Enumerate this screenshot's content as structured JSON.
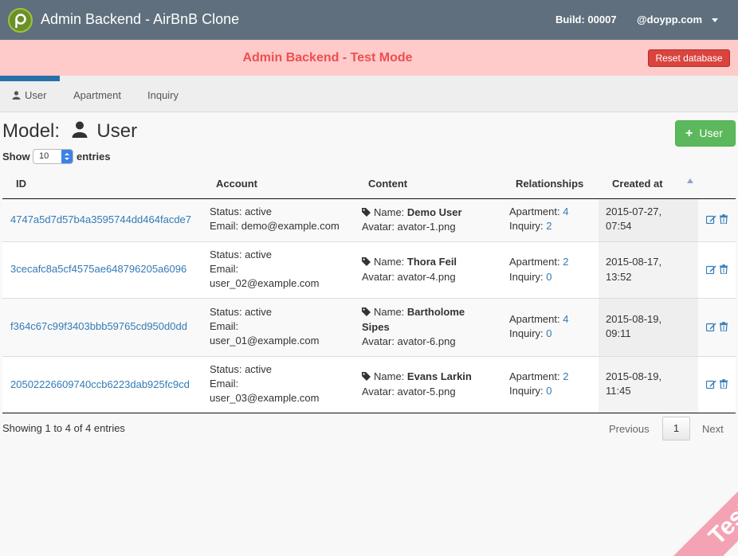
{
  "app": {
    "title": "Admin Backend - AirBnB Clone",
    "build": "Build: 00007",
    "user": "@doypp.com"
  },
  "banner": {
    "title": "Admin Backend - Test Mode",
    "reset_label": "Reset database"
  },
  "tabs": [
    {
      "label": "User",
      "active": true
    },
    {
      "label": "Apartment",
      "active": false
    },
    {
      "label": "Inquiry",
      "active": false
    }
  ],
  "model": {
    "prefix": "Model:",
    "name": "User",
    "add_label": "User"
  },
  "entries": {
    "show": "Show",
    "value": "10",
    "suffix": "entries"
  },
  "table": {
    "columns": [
      "ID",
      "Account",
      "Content",
      "Relationships",
      "Created at"
    ],
    "rows": [
      {
        "id": "4747a5d7d57b4a3595744dd464facde7",
        "status": "Status: active",
        "email_prefix": "Email:",
        "email": "demo@example.com",
        "name_prefix": "Name:",
        "name": "Demo User",
        "avatar": "Avatar: avator-1.png",
        "apartment_label": "Apartment:",
        "apartment": "4",
        "inquiry_label": "Inquiry:",
        "inquiry": "2",
        "created_date": "2015-07-27,",
        "created_time": "07:54"
      },
      {
        "id": "3cecafc8a5cf4575ae648796205a6096",
        "status": "Status: active",
        "email_prefix": "Email:",
        "email": "user_02@example.com",
        "name_prefix": "Name:",
        "name": "Thora Feil",
        "avatar": "Avatar: avator-4.png",
        "apartment_label": "Apartment:",
        "apartment": "2",
        "inquiry_label": "Inquiry:",
        "inquiry": "0",
        "created_date": "2015-08-17,",
        "created_time": "13:52"
      },
      {
        "id": "f364c67c99f3403bbb59765cd950d0dd",
        "status": "Status: active",
        "email_prefix": "Email:",
        "email": "user_01@example.com",
        "name_prefix": "Name:",
        "name_line1": "Bartholome",
        "name_line2": "Sipes",
        "avatar": "Avatar: avator-6.png",
        "apartment_label": "Apartment:",
        "apartment": "4",
        "inquiry_label": "Inquiry:",
        "inquiry": "0",
        "created_date": "2015-08-19,",
        "created_time": "09:11"
      },
      {
        "id": "20502226609740ccb6223dab925fc9cd",
        "status": "Status: active",
        "email_prefix": "Email:",
        "email": "user_03@example.com",
        "name_prefix": "Name:",
        "name": "Evans Larkin",
        "avatar": "Avatar: avator-5.png",
        "apartment_label": "Apartment:",
        "apartment": "2",
        "inquiry_label": "Inquiry:",
        "inquiry": "0",
        "created_date": "2015-08-19,",
        "created_time": "11:45"
      }
    ]
  },
  "footer": {
    "info": "Showing 1 to 4 of 4 entries",
    "previous": "Previous",
    "page": "1",
    "next": "Next"
  },
  "ribbon": {
    "label": "Test"
  },
  "colors": {
    "navbar": "#5f6f7d",
    "banner_bg": "#fecaca",
    "banner_text": "#ee4f4f",
    "danger": "#d9443f",
    "success": "#5cb85c",
    "link": "#337ab7"
  },
  "icons": {
    "logo": "logo-icon",
    "user": "user-icon",
    "tag": "tag-icon",
    "edit": "edit-icon",
    "trash": "trash-icon",
    "plus": "plus-icon",
    "caret": "caret-down-icon",
    "sort": "sort-asc-icon"
  }
}
